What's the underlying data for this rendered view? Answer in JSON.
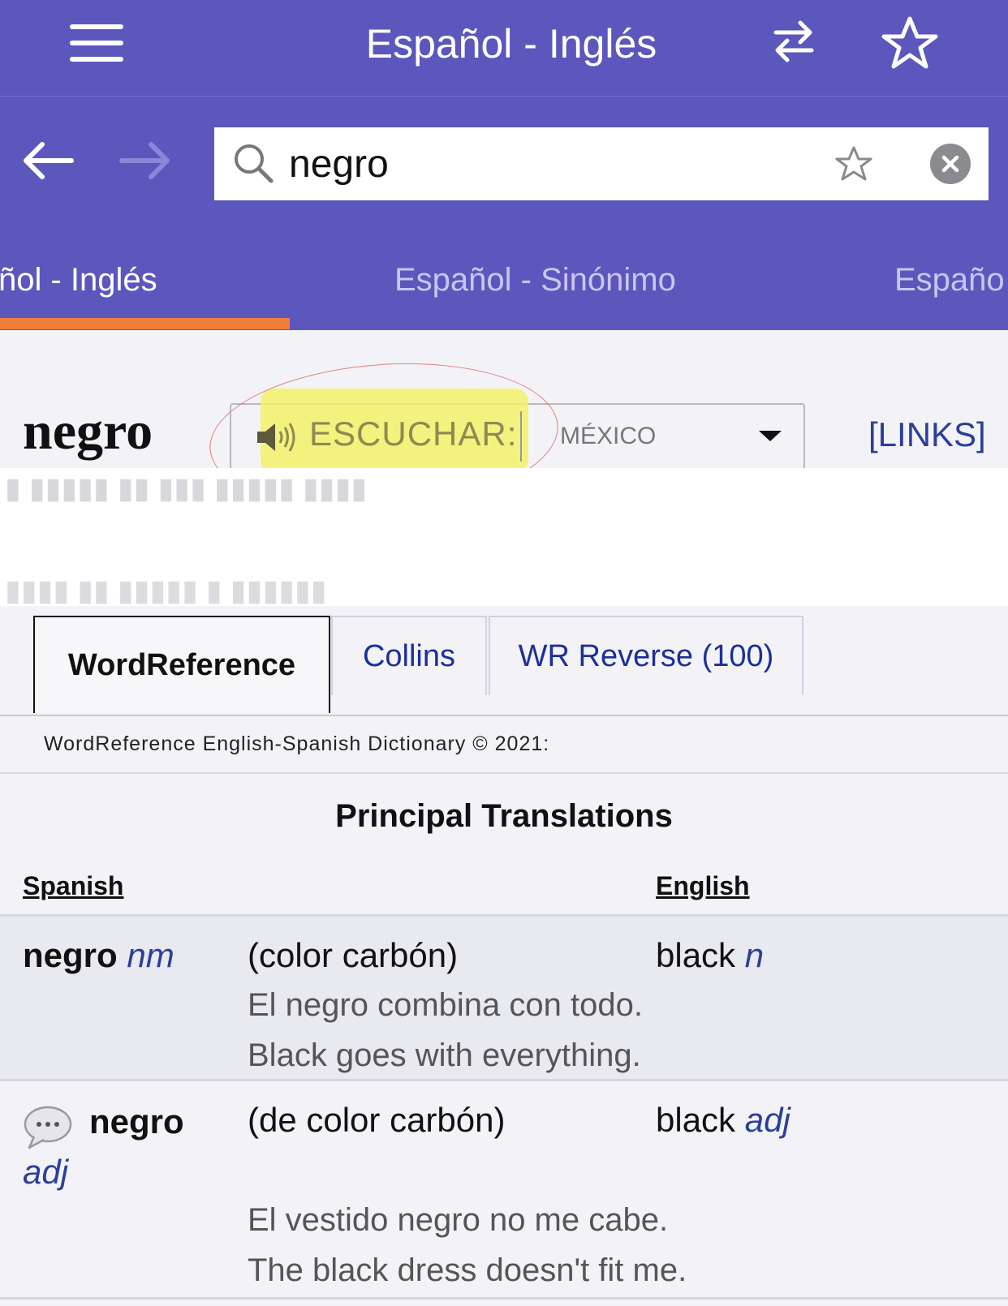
{
  "header": {
    "title": "Español - Inglés"
  },
  "search": {
    "value": "negro"
  },
  "tabs": [
    {
      "label": "Español - Inglés",
      "visible_text": "ñol - Inglés",
      "active": true
    },
    {
      "label": "Español - Sinónimo",
      "visible_text": "Español - Sinónimo",
      "active": false
    },
    {
      "label": "Español",
      "visible_text": "Españo",
      "active": false
    }
  ],
  "entry": {
    "headword": "negro",
    "listen_label": "ESCUCHAR:",
    "region": "MÉXICO",
    "links": "[LINKS]"
  },
  "source_tabs": [
    {
      "label": "WordReference"
    },
    {
      "label": "Collins"
    },
    {
      "label": "WR Reverse (100)"
    }
  ],
  "dictionary": {
    "credit": "WordReference English-Spanish Dictionary © 2021:",
    "section_title": "Principal Translations",
    "col_spanish": "Spanish",
    "col_english": "English",
    "rows": [
      {
        "term": "negro",
        "pos": "nm",
        "sense": "(color carbón)",
        "english": "black",
        "english_pos": "n",
        "example_es": "El negro combina con todo.",
        "example_en": "Black goes with everything."
      },
      {
        "term": "negro",
        "pos": "adj",
        "sense": "(de color carbón)",
        "english": "black",
        "english_pos": "adj",
        "example_es": "El vestido negro no me cabe.",
        "example_en": "The black dress doesn't fit me."
      }
    ]
  },
  "colors": {
    "header_bg": "#5c57bd",
    "tab_underline": "#f07f3c",
    "link": "#2b3f9a",
    "highlight": "#f2f16a"
  },
  "icons": [
    "menu-icon",
    "swap-icon",
    "star-icon",
    "back-arrow-icon",
    "forward-arrow-icon",
    "search-icon",
    "favorite-star-icon",
    "clear-icon",
    "speaker-icon",
    "caret-down-icon",
    "speech-bubble-icon"
  ]
}
